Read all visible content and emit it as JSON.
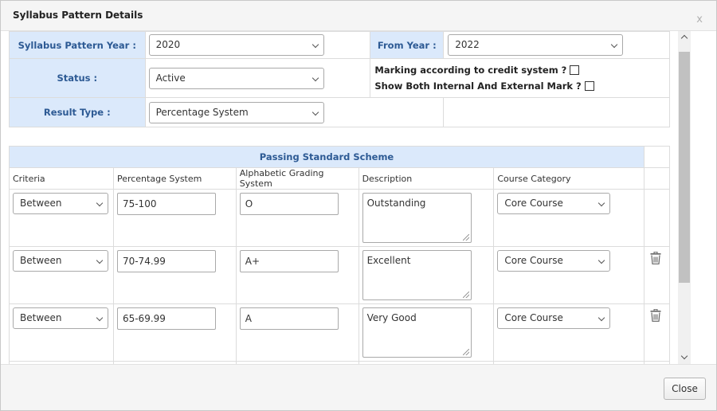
{
  "dialog": {
    "title": "Syllabus Pattern Details",
    "close_x": "x",
    "close_button": "Close"
  },
  "form": {
    "syllabus_year_label": "Syllabus Pattern Year :",
    "syllabus_year_value": "2020",
    "from_year_label": "From Year :",
    "from_year_value": "2022",
    "status_label": "Status :",
    "status_value": "Active",
    "marking_credit_label": "Marking according to credit system ?",
    "marking_credit_checked": false,
    "show_both_label": "Show Both Internal And External Mark ?",
    "show_both_checked": false,
    "result_type_label": "Result Type :",
    "result_type_value": "Percentage System"
  },
  "scheme": {
    "title": "Passing Standard Scheme",
    "columns": [
      "Criteria",
      "Percentage System",
      "Alphabetic Grading System",
      "Description",
      "Course Category"
    ],
    "rows": [
      {
        "criteria": "Between",
        "percentage": "75-100",
        "grade": "O",
        "description": "Outstanding",
        "category": "Core Course",
        "deletable": false
      },
      {
        "criteria": "Between",
        "percentage": "70-74.99",
        "grade": "A+",
        "description": "Excellent",
        "category": "Core Course",
        "deletable": true
      },
      {
        "criteria": "Between",
        "percentage": "65-69.99",
        "grade": "A",
        "description": "Very Good",
        "category": "Core Course",
        "deletable": true
      }
    ]
  },
  "icons": {
    "trash": "trash-icon",
    "chevron": "chevron-down-icon"
  },
  "colors": {
    "label_bg": "#dbe9fb",
    "label_text": "#2d5a94"
  }
}
